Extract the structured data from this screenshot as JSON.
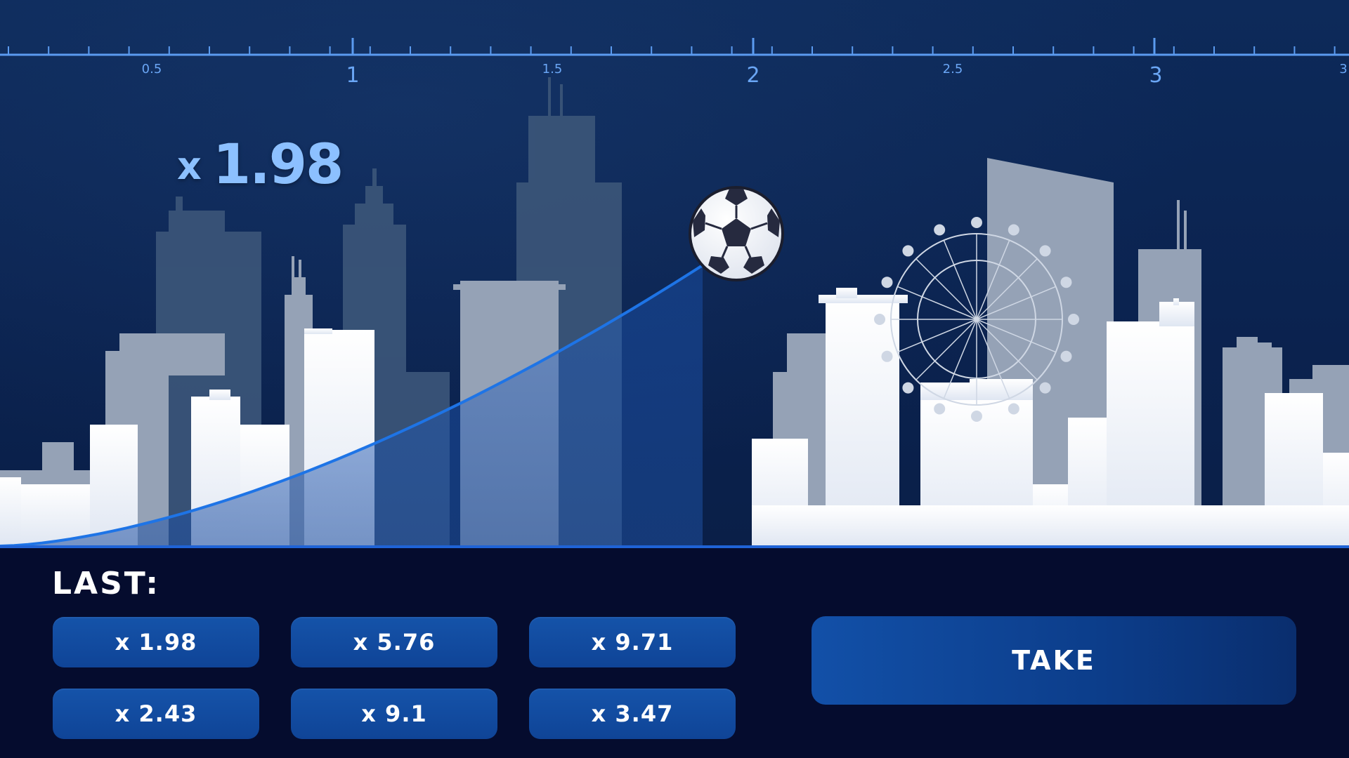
{
  "game": {
    "current_multiplier": "1.98",
    "multiplier_prefix": "x"
  },
  "ruler": {
    "labels": [
      "0.5",
      "1",
      "1.5",
      "2",
      "2.5",
      "3",
      "3"
    ]
  },
  "history": {
    "label": "LAST:",
    "items": [
      "x 1.98",
      "x 5.76",
      "x 9.71",
      "x 2.43",
      "x 9.1",
      "x 3.47"
    ]
  },
  "actions": {
    "take_label": "TAKE"
  },
  "colors": {
    "accent_blue": "#1f63d6",
    "multiplier_text": "#8cc0ff",
    "button_blue": "#1553a9",
    "panel_bg": "#050c2e"
  },
  "icons": {
    "ball": "soccer-ball-icon",
    "wheel": "ferris-wheel"
  }
}
